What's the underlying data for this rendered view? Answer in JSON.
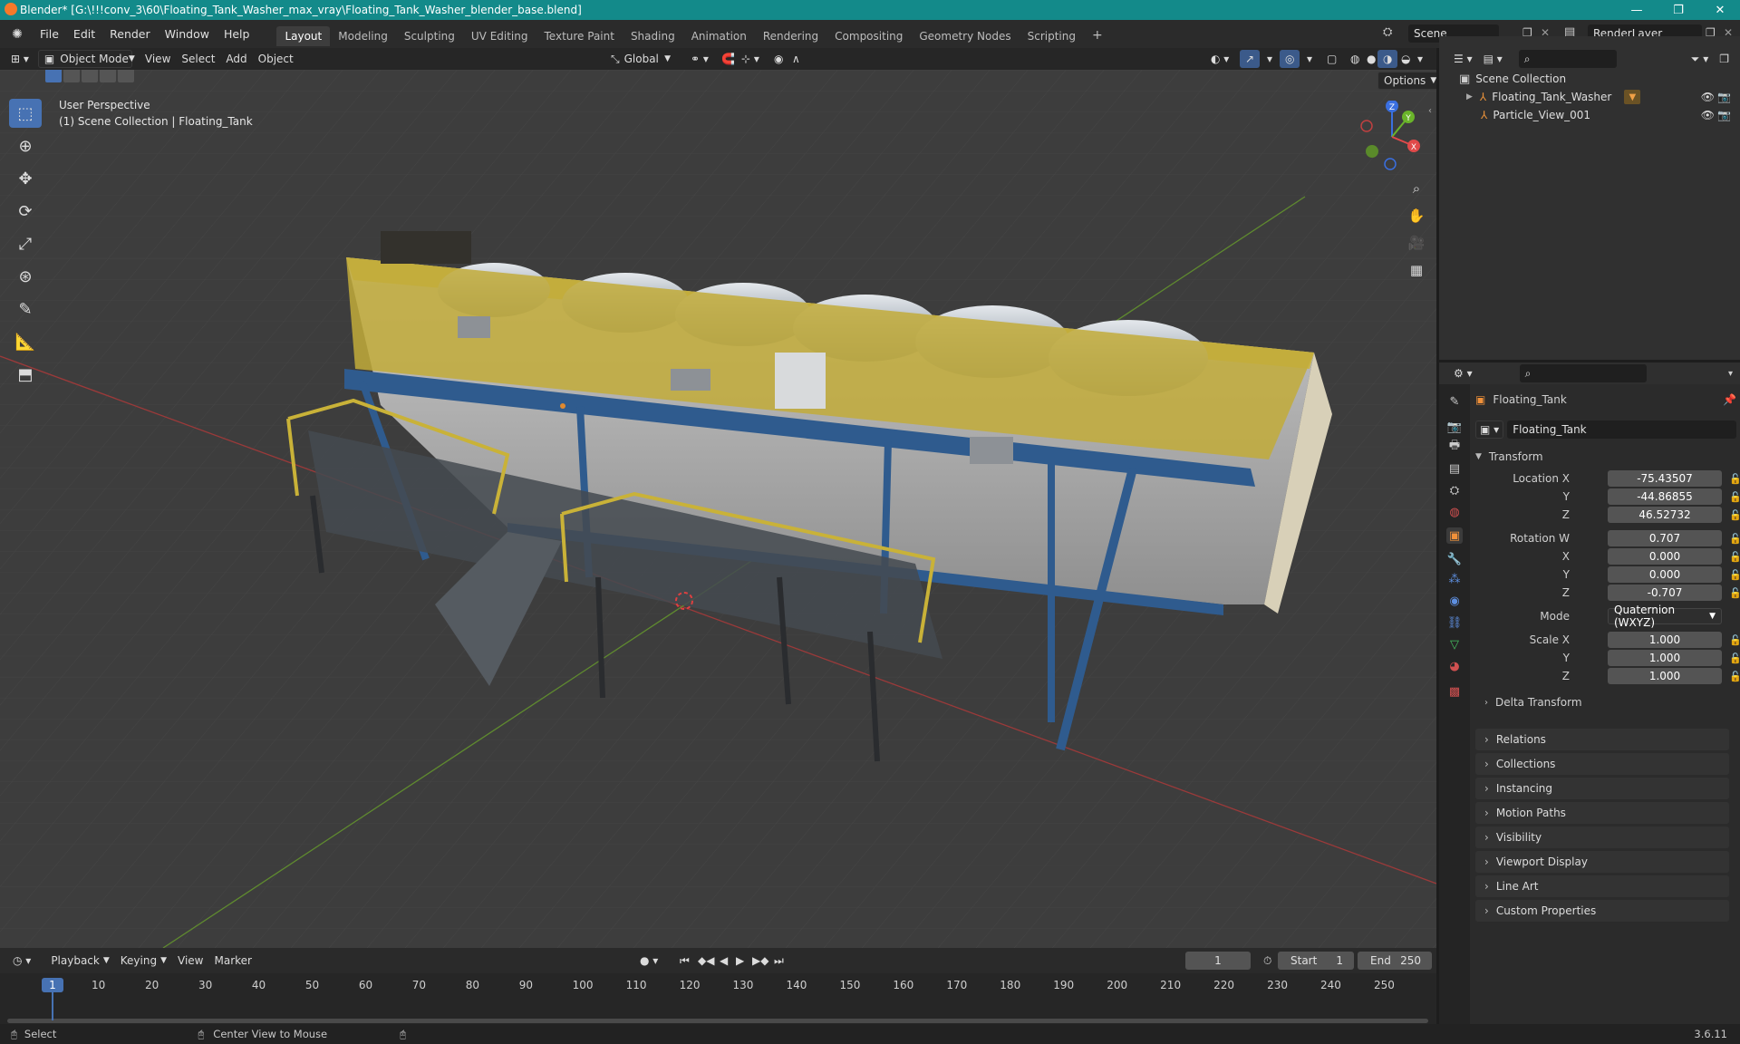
{
  "window": {
    "title": "Blender* [G:\\!!!conv_3\\60\\Floating_Tank_Washer_max_vray\\Floating_Tank_Washer_blender_base.blend]",
    "minimize": "—",
    "maximize": "❐",
    "close": "✕"
  },
  "menus": [
    "File",
    "Edit",
    "Render",
    "Window",
    "Help"
  ],
  "workspaces": [
    "Layout",
    "Modeling",
    "Sculpting",
    "UV Editing",
    "Texture Paint",
    "Shading",
    "Animation",
    "Rendering",
    "Compositing",
    "Geometry Nodes",
    "Scripting"
  ],
  "active_workspace": "Layout",
  "add_workspace": "+",
  "scene": {
    "name": "Scene",
    "render_layer": "RenderLayer"
  },
  "viewport_header": {
    "mode": "Object Mode",
    "menus": [
      "View",
      "Select",
      "Add",
      "Object"
    ],
    "orientation": "Global",
    "options": "Options"
  },
  "viewport": {
    "perspective": "User Perspective",
    "collection_info": "(1) Scene Collection | Floating_Tank",
    "gizmo": {
      "x": "X",
      "y": "Y",
      "z": "Z"
    }
  },
  "outliner": {
    "root": "Scene Collection",
    "items": [
      "Floating_Tank_Washer",
      "Particle_View_001"
    ]
  },
  "properties": {
    "object_name": "Floating_Tank",
    "data_name": "Floating_Tank",
    "transform_header": "Transform",
    "location_label": "Location X",
    "location": {
      "x": "-75.43507",
      "y": "-44.86855",
      "z": "46.52732"
    },
    "rotation_label": "Rotation W",
    "rotation": {
      "w": "0.707",
      "x": "0.000",
      "y": "0.000",
      "z": "-0.707"
    },
    "mode_label": "Mode",
    "mode_value": "Quaternion (WXYZ)",
    "scale_label": "Scale X",
    "scale": {
      "x": "1.000",
      "y": "1.000",
      "z": "1.000"
    },
    "axis_labels": {
      "y": "Y",
      "z": "Z",
      "x": "X"
    },
    "delta_transform": "Delta Transform",
    "panels": [
      "Relations",
      "Collections",
      "Instancing",
      "Motion Paths",
      "Visibility",
      "Viewport Display",
      "Line Art",
      "Custom Properties"
    ]
  },
  "timeline": {
    "menus": [
      "Playback",
      "Keying",
      "View",
      "Marker"
    ],
    "current_frame": "1",
    "start_label": "Start",
    "start": "1",
    "end_label": "End",
    "end": "250",
    "ticks": [
      "1",
      "10",
      "20",
      "30",
      "40",
      "50",
      "60",
      "70",
      "80",
      "90",
      "100",
      "110",
      "120",
      "130",
      "140",
      "150",
      "160",
      "170",
      "180",
      "190",
      "200",
      "210",
      "220",
      "230",
      "240",
      "250"
    ]
  },
  "status": {
    "select": "Select",
    "center": "Center View to Mouse",
    "version": "3.6.11"
  },
  "colors": {
    "accent": "#4772b3",
    "titlebar": "#138a8a",
    "frame_marker": "#4772b3"
  }
}
